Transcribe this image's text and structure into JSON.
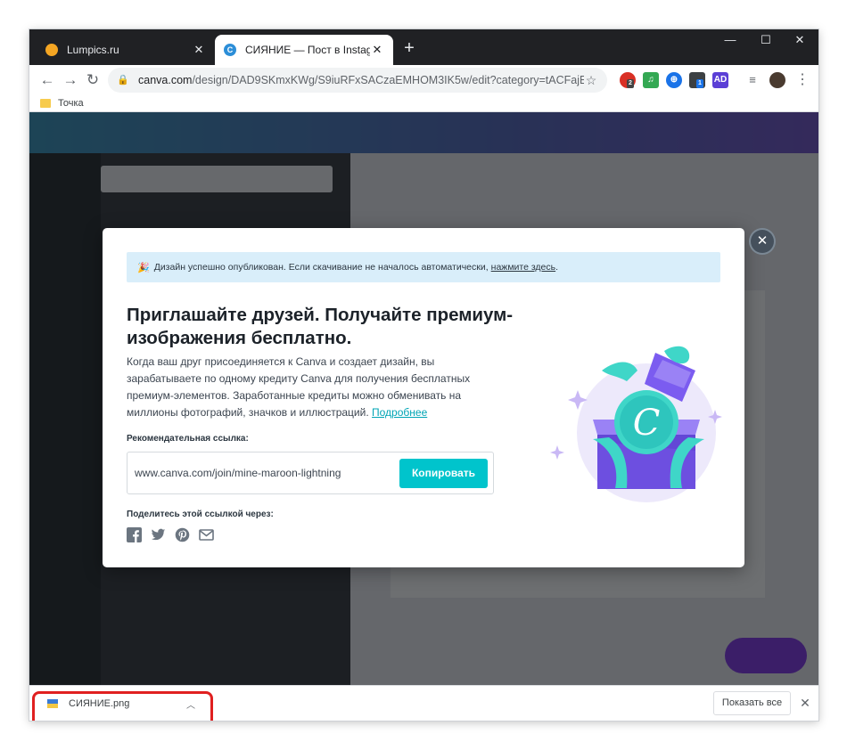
{
  "browser": {
    "tabs": [
      {
        "title": "Lumpics.ru",
        "close": "✕"
      },
      {
        "title": "СИЯНИЕ — Пост в Instagram",
        "close": "✕"
      }
    ],
    "new_tab": "+",
    "window_controls": {
      "minimize": "—",
      "maximize": "☐",
      "close": "✕"
    },
    "url_host": "canva.com",
    "url_rest": "/design/DAD9SKmxKWg/S9iuRFxSACzaEMHOM3IK5w/edit?category=tACFajEYUAM...",
    "bookmark": "Точка",
    "extension_badges": [
      "2",
      "1"
    ]
  },
  "modal": {
    "notice_text": "Дизайн успешно опубликован. Если скачивание не началось автоматически,",
    "notice_link": "нажмите здесь",
    "notice_end": ".",
    "heading": "Приглашайте друзей. Получайте премиум-изображения бесплатно.",
    "description": "Когда ваш друг присоединяется к Canva и создает дизайн, вы зарабатываете по одному кредиту Canva для получения бесплатных премиум-элементов. Заработанные кредиты можно обменивать на миллионы фотографий, значков и иллюстраций.",
    "more_link": "Подробнее",
    "ref_label": "Рекомендательная ссылка:",
    "ref_url": "www.canva.com/join/mine-maroon-lightning",
    "copy_button": "Копировать",
    "share_label": "Поделитесь этой ссылкой через:",
    "share_icons": [
      "facebook-icon",
      "twitter-icon",
      "pinterest-icon",
      "email-icon"
    ],
    "illustration_letter": "C"
  },
  "download_bar": {
    "file_name": "СИЯНИЕ.png",
    "show_all": "Показать все",
    "close": "✕"
  },
  "colors": {
    "accent": "#00c4cc",
    "link": "#00a5b5",
    "highlight": "#e02020"
  }
}
